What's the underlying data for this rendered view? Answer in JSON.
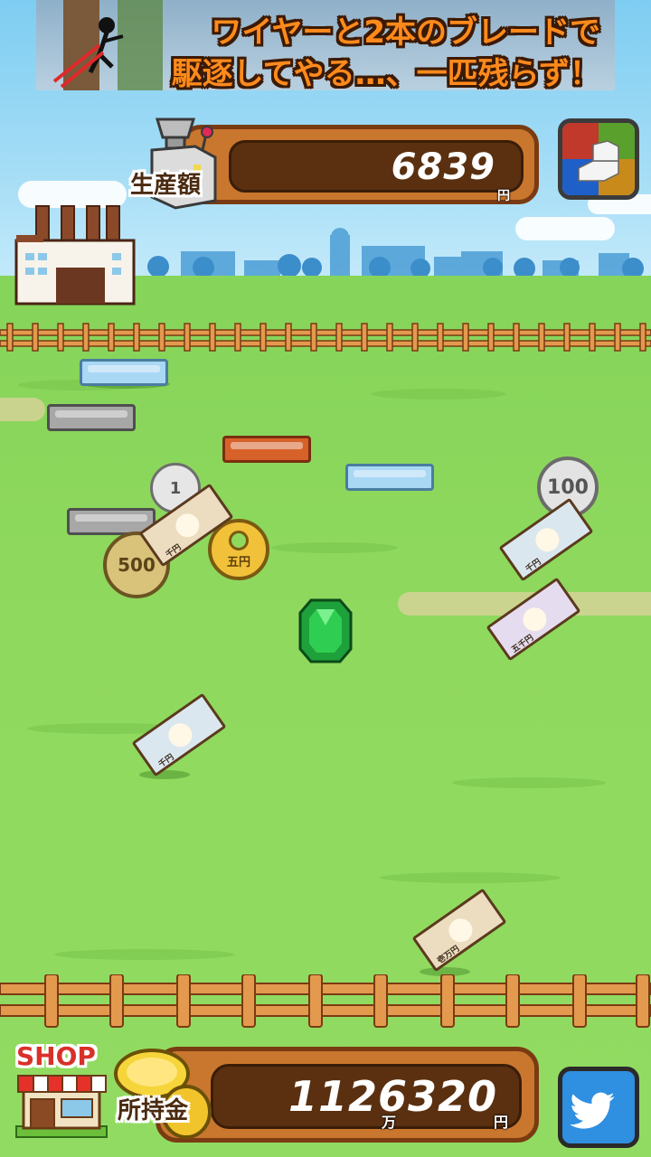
{
  "ad_banner": {
    "line1": "ワイヤーと2本のブレードで",
    "line2": "駆逐してやる…、一匹残らず！"
  },
  "production": {
    "label": "生産額",
    "value": "6839",
    "unit": "円"
  },
  "money": {
    "label": "所持金",
    "value": "1126320",
    "unit_man": "万",
    "unit_yen": "円"
  },
  "shop": {
    "label": "SHOP"
  },
  "icons": {
    "menu": "menu-icon",
    "twitter": "twitter-bird-icon",
    "factory": "factory-icon",
    "machine": "money-machine-icon",
    "coins": "gold-coin-stack-icon"
  },
  "field_items": {
    "coin_1": "1",
    "coin_5": "五円",
    "coin_100": "100",
    "coin_500": "500",
    "note_1000_a": "千円",
    "note_1000_b": "千円",
    "note_1000_c": "千円",
    "note_5000": "五千円",
    "note_10000": "壱万円"
  },
  "colors": {
    "panel_fill": "#c9772e",
    "panel_border": "#7a3b12",
    "display_bg": "#5a3010",
    "grass": "#8fd95e",
    "sky": "#7ecdf2",
    "twitter_blue": "#2f8fe0"
  }
}
